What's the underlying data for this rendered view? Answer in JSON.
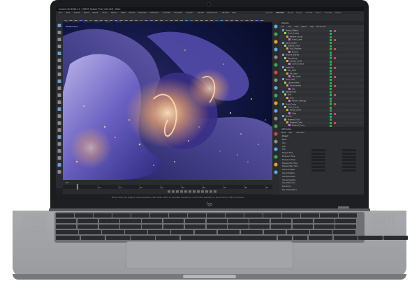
{
  "window": {
    "title": "Cinema 4D 2024.1.0 - [SHOT_Splash_Fluid_v04.c4d] - Main",
    "tabs": [
      "Layouts",
      "Standard",
      "Model",
      "Sculpt",
      "UV Edit",
      "Paint",
      "Animate",
      "Nodes"
    ]
  },
  "menu": {
    "items": [
      "File",
      "Edit",
      "Create",
      "Modes",
      "Select",
      "Tools",
      "Spline",
      "Mesh",
      "Volume",
      "MoGraph",
      "Character",
      "Animate",
      "Simulate",
      "Tracker",
      "Render",
      "Extensions",
      "Window",
      "Help"
    ]
  },
  "viewport": {
    "menu": [
      "View",
      "Cameras",
      "Display",
      "Options",
      "Filter",
      "Panel"
    ],
    "label": "Perspective"
  },
  "objects_panel": {
    "header": "Objects",
    "tabs": [
      "File",
      "Edit",
      "View",
      "Object",
      "Tags",
      "Bookmarks"
    ],
    "items": [
      "Splash_Master",
      "Fluid_Emitter",
      "Particle_Group",
      "Foam_Layer",
      "Spray_Detail",
      "Droplet_Cloud",
      "Sub_Droplets",
      "Mesher",
      "Volume_Builder",
      "Smoothing",
      "Collider_Cloth",
      "Cloth_Surface",
      "Light_Rig",
      "Key_Light",
      "Fill_Light",
      "Rim_Light",
      "Area_Light",
      "Camera_Main",
      "Environment",
      "Sky",
      "Background",
      "Null",
      "Floor",
      "Render_Settings",
      "Fluid_Cache",
      "Foam_Cache",
      "Spray_Cache",
      "Glow",
      "Shader",
      "Material_Fluid",
      "Material_Cloth",
      "Material_Foam"
    ]
  },
  "attributes_panel": {
    "header": "Attributes",
    "tabs": [
      "Mode",
      "Edit",
      "User Data"
    ],
    "section": "Project",
    "rows": [
      "Basic",
      "Info",
      "Todo",
      "FPS",
      "Project Time",
      "Minimum Time",
      "Maximum Time",
      "Preview Min Time",
      "Preview Max Time",
      "Level of Detail",
      "Use Animation",
      "Use Expression",
      "Use Generators",
      "Use Deformers",
      "Dynamics",
      "Key Interpolation"
    ]
  },
  "timeline": {
    "frame_labels": [
      "0",
      "10",
      "20",
      "30",
      "40",
      "50",
      "60",
      "70",
      "80",
      "90"
    ],
    "current_frame": "0 F"
  },
  "status": {
    "text": "Move: Click and drag to move elements. Hold down SHIFT to quantize movement / add to the selection in point mode, CTRL to remove."
  },
  "device": {
    "logo": "hp"
  },
  "colors": {
    "accent": "#4a90d9",
    "scene_glow": "#f2a86b",
    "scene_fluid": "#7b6fd6"
  }
}
